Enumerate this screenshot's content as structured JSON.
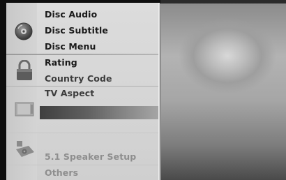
{
  "menu": {
    "items": [
      {
        "label": "Disc Audio"
      },
      {
        "label": "Disc Subtitle"
      },
      {
        "label": "Disc Menu"
      },
      {
        "label": "Rating"
      },
      {
        "label": "Country Code"
      },
      {
        "label": "TV Aspect"
      },
      {
        "label": "5.1 Speaker Setup"
      },
      {
        "label": "Others"
      }
    ],
    "selected_index": 6
  },
  "icons": [
    "disc-icon",
    "lock-icon",
    "tv-icon",
    "speaker-icon"
  ],
  "colors": {
    "panel": "#d8d8d8",
    "highlight_start": "#3f3f3f",
    "highlight_end": "#a5a5a5",
    "text_dark": "#1a1a1a",
    "text_faded": "#8e8e8e"
  }
}
